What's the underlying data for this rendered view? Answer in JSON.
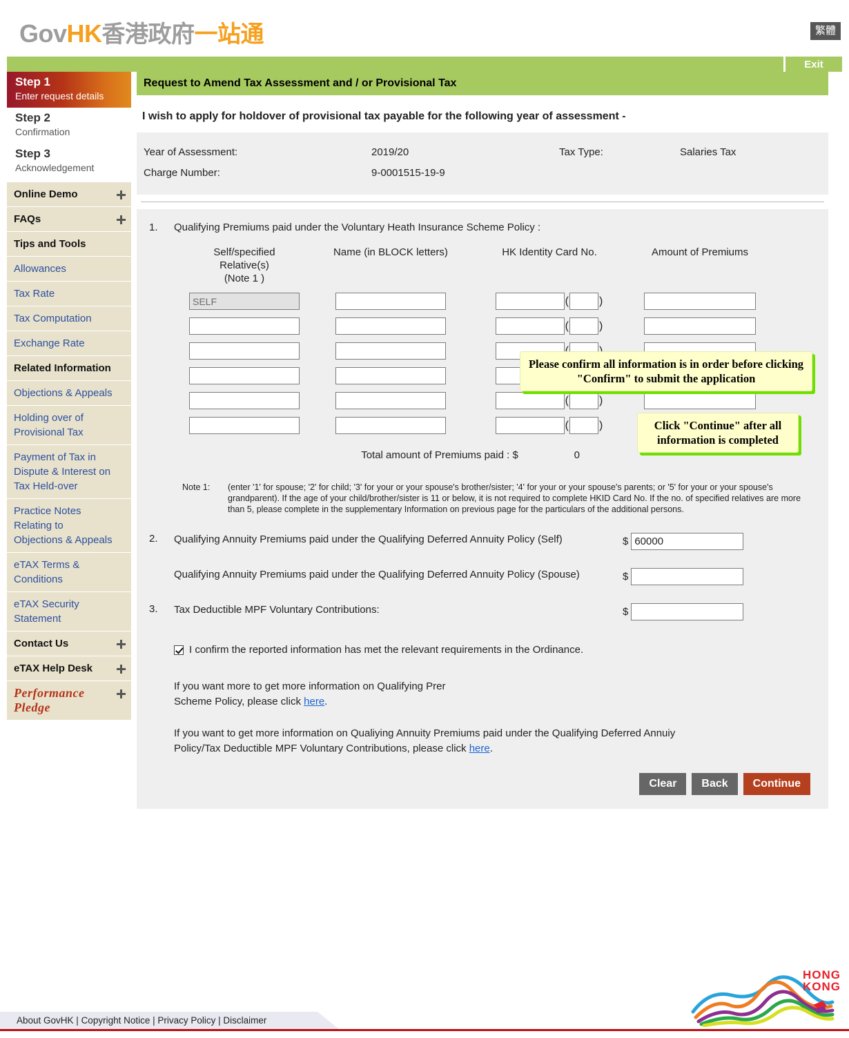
{
  "header": {
    "logo_gov": "Gov",
    "logo_hk": "HK",
    "logo_cn_grey": "香港政府",
    "logo_cn_orange": "一站通",
    "lang_toggle": "繁體",
    "exit_label": "Exit"
  },
  "sidebar": {
    "steps": [
      {
        "title": "Step 1",
        "sub": "Enter request details",
        "active": true
      },
      {
        "title": "Step 2",
        "sub": "Confirmation",
        "active": false
      },
      {
        "title": "Step 3",
        "sub": "Acknowledgement",
        "active": false
      }
    ],
    "items": [
      {
        "label": "Online Demo",
        "type": "head",
        "icon": "expand-plus-icon"
      },
      {
        "label": "FAQs",
        "type": "head",
        "icon": "expand-plus-icon"
      },
      {
        "label": "Tips and Tools",
        "type": "head",
        "icon": ""
      },
      {
        "label": "Allowances",
        "type": "link",
        "icon": ""
      },
      {
        "label": "Tax Rate",
        "type": "link",
        "icon": ""
      },
      {
        "label": "Tax Computation",
        "type": "link",
        "icon": ""
      },
      {
        "label": "Exchange Rate",
        "type": "link",
        "icon": ""
      },
      {
        "label": "Related Information",
        "type": "head",
        "icon": ""
      },
      {
        "label": "Objections & Appeals",
        "type": "link",
        "icon": ""
      },
      {
        "label": "Holding over of Provisional Tax",
        "type": "link",
        "icon": ""
      },
      {
        "label": "Payment of Tax in Dispute & Interest on Tax Held-over",
        "type": "link",
        "icon": ""
      },
      {
        "label": "Practice Notes Relating to Objections & Appeals",
        "type": "link",
        "icon": ""
      },
      {
        "label": "eTAX Terms & Conditions",
        "type": "link",
        "icon": ""
      },
      {
        "label": "eTAX Security Statement",
        "type": "link",
        "icon": ""
      },
      {
        "label": "Contact Us",
        "type": "head",
        "icon": "expand-plus-icon"
      },
      {
        "label": "eTAX Help Desk",
        "type": "head",
        "icon": "expand-plus-icon"
      }
    ],
    "performance_pledge_line1": "Performance",
    "performance_pledge_line2": "Pledge"
  },
  "main": {
    "page_title": "Request to Amend Tax Assessment and / or Provisional Tax",
    "intro": "I wish to apply for holdover of provisional tax payable for the following year of assessment -",
    "assessment": {
      "year_label": "Year of Assessment:",
      "year_value": "2019/20",
      "tax_type_label": "Tax Type:",
      "tax_type_value": "Salaries Tax",
      "charge_label": "Charge Number:",
      "charge_value": "9-0001515-19-9"
    },
    "q1": {
      "num": "1.",
      "text": "Qualifying Premiums paid under the Voluntary Heath Insurance Scheme Policy :",
      "columns": {
        "relative_l1": "Self/specified",
        "relative_l2": "Relative(s)",
        "relative_l3": "(Note 1 )",
        "name": "Name (in BLOCK letters)",
        "hkid": "HK Identity Card No.",
        "amount": "Amount of Premiums"
      },
      "rows": [
        {
          "relative": "SELF",
          "relative_disabled": true,
          "name": "",
          "hkid": "",
          "hkid_check": "",
          "amount": ""
        },
        {
          "relative": "",
          "relative_disabled": false,
          "name": "",
          "hkid": "",
          "hkid_check": "",
          "amount": ""
        },
        {
          "relative": "",
          "relative_disabled": false,
          "name": "",
          "hkid": "",
          "hkid_check": "",
          "amount": ""
        },
        {
          "relative": "",
          "relative_disabled": false,
          "name": "",
          "hkid": "",
          "hkid_check": "",
          "amount": ""
        },
        {
          "relative": "",
          "relative_disabled": false,
          "name": "",
          "hkid": "",
          "hkid_check": "",
          "amount": ""
        },
        {
          "relative": "",
          "relative_disabled": false,
          "name": "",
          "hkid": "",
          "hkid_check": "",
          "amount": ""
        }
      ],
      "total_label": "Total amount of Premiums paid : $",
      "total_value": "0"
    },
    "note1": {
      "label": "Note 1:",
      "text": "(enter '1' for spouse; '2' for child; '3' for your or your spouse's brother/sister; '4' for your or your spouse's parents; or '5' for your or your spouse's grandparent). If the age of your child/brother/sister is 11 or below, it is not required to complete HKID Card No. If the no. of specified relatives are more than 5, please complete in the supplementary Information on previous page for the particulars of the additional persons."
    },
    "q2": {
      "num": "2.",
      "self_label": "Qualifying Annuity Premiums paid under the Qualifying Deferred Annuity Policy (Self)",
      "self_dollar": "$",
      "self_value": "60000",
      "spouse_label": "Qualifying Annuity Premiums paid under the Qualifying Deferred Annuity Policy (Spouse)",
      "spouse_dollar": "$",
      "spouse_value": ""
    },
    "q3": {
      "num": "3.",
      "label": "Tax Deductible MPF Voluntary Contributions:",
      "dollar": "$",
      "value": ""
    },
    "confirm": {
      "checked": true,
      "label": "I confirm the reported information has met the relevant requirements in the Ordinance."
    },
    "para1_before": "If you want more to get more information on Qualifying Prer",
    "para1_after": "Scheme Policy, please click ",
    "para1_link": "here",
    "para1_end": ".",
    "para2_before": "If you want to get more information on Qualiying Annuity Premiums paid under the Qualifying Deferred Annuiy",
    "para2_after": "Policy/Tax Deductible MPF Voluntary Contributions, please click ",
    "para2_link": "here",
    "para2_end": ".",
    "tooltip1": "Please confirm all information is in order before clicking \"Confirm\" to submit the application",
    "tooltip2": "Click \"Continue\" after all information is completed",
    "buttons": {
      "clear": "Clear",
      "back": "Back",
      "continue": "Continue"
    }
  },
  "footer": {
    "links": [
      "About GovHK",
      "Copyright Notice",
      "Privacy Policy",
      "Disclaimer"
    ],
    "separator": " | ",
    "brand_line1": "HONG",
    "brand_line2": "KONG"
  }
}
